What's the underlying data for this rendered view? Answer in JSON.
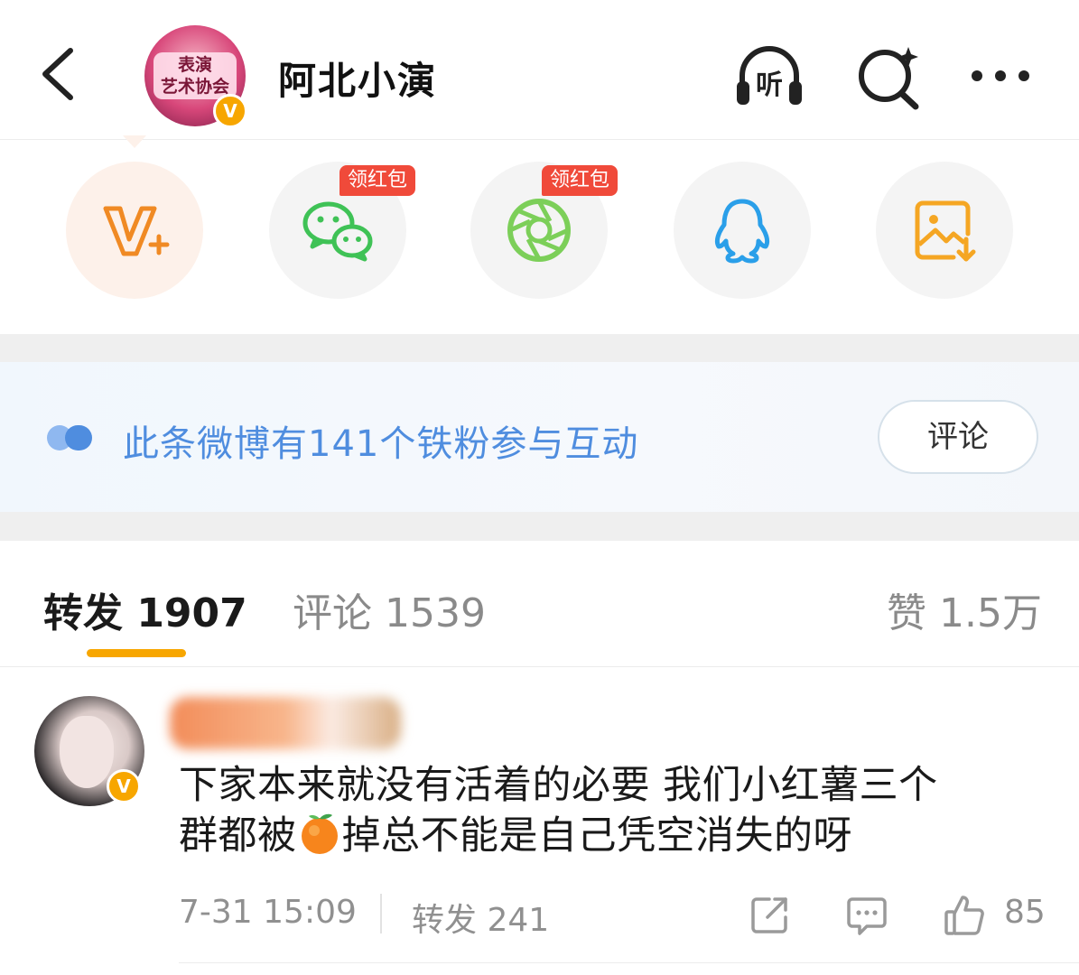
{
  "header": {
    "title": "阿北小演",
    "avatar_text_line1": "表演",
    "avatar_text_line2": "艺术协会",
    "listen_label": "听",
    "verified_mark": "V"
  },
  "share": {
    "redpack_label": "领红包",
    "items": [
      "vplus",
      "wechat",
      "moments",
      "qq",
      "save-image"
    ]
  },
  "fans_bar": {
    "text": "此条微博有141个铁粉参与互动",
    "button": "评论"
  },
  "tabs": {
    "repost": "转发 1907",
    "comment": "评论 1539",
    "like": "赞 1.5万"
  },
  "comment": {
    "verified_mark": "V",
    "text_line1": "下家本来就没有活着的必要 我们小红薯三个",
    "text_line2_before": "群都被",
    "text_line2_after": "掉总不能是自己凭空消失的呀",
    "time": "7-31 15:09",
    "repost": "转发 241",
    "likes": "85"
  },
  "colors": {
    "accent": "#f7a600",
    "link_blue": "#4f8ddf",
    "red_badge": "#f04a3a"
  }
}
